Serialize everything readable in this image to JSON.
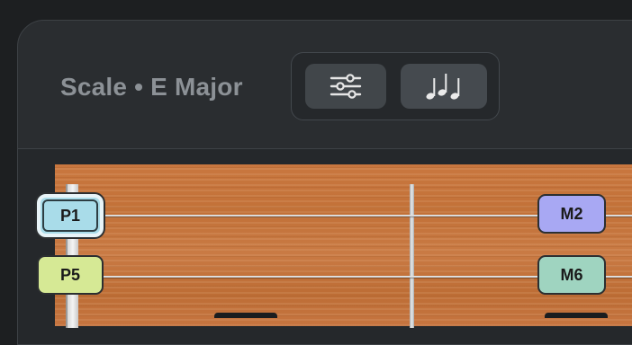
{
  "header": {
    "title": "Scale • E Major",
    "buttons": [
      {
        "name": "settings",
        "icon": "sliders-icon"
      },
      {
        "name": "notes",
        "icon": "music-notes-icon"
      }
    ]
  },
  "fretboard": {
    "notes": [
      {
        "label": "P1",
        "color": "#a9dce9",
        "selected": true
      },
      {
        "label": "M2",
        "color": "#a8a8f3"
      },
      {
        "label": "P5",
        "color": "#d6e995"
      },
      {
        "label": "M6",
        "color": "#9fd4c0"
      }
    ]
  },
  "colors": {
    "background": "#2a2d30",
    "wood": "#c27138",
    "title": "#8c9196"
  }
}
